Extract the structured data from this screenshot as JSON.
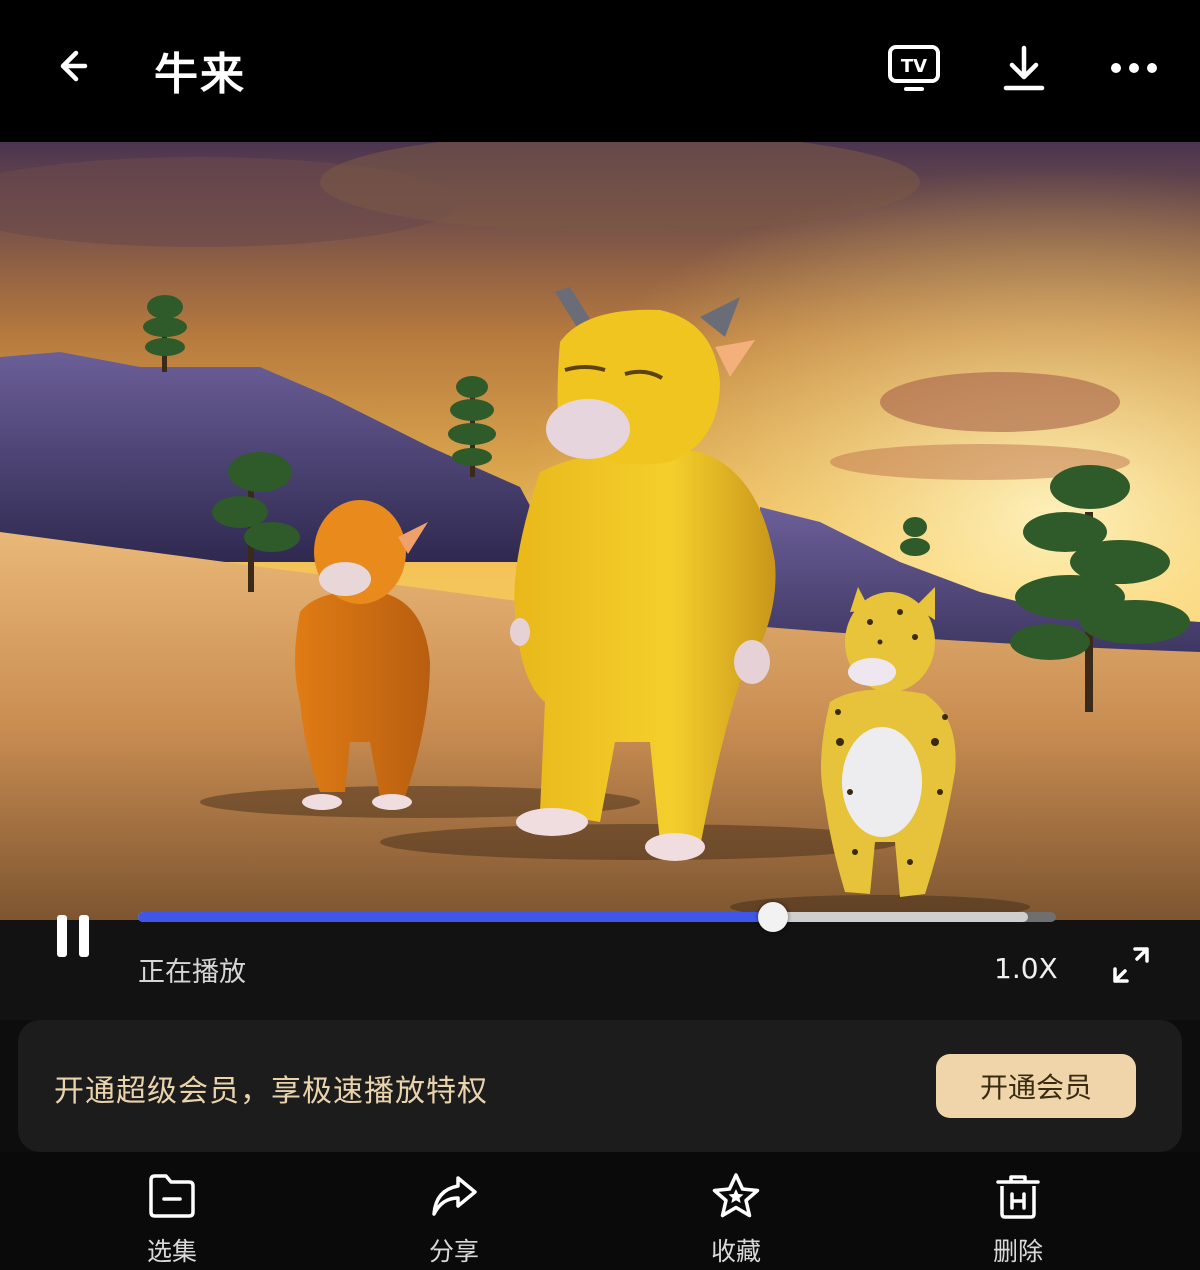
{
  "header": {
    "title": "牛来",
    "back_icon": "arrow-left-icon",
    "tv_icon": "tv-cast-icon",
    "tv_label": "TV",
    "download_icon": "download-icon",
    "more_icon": "more-horizontal-icon"
  },
  "player": {
    "status_text": "正在播放",
    "speed": "1.0X",
    "progress": 0.692,
    "buffered": 0.97,
    "progress_color": "#3f57e8",
    "pause_icon": "pause-icon",
    "fullscreen_icon": "fullscreen-icon"
  },
  "promo": {
    "text": "开通超级会员，享极速播放特权",
    "button": "开通会员",
    "accent_color": "#efd5a9"
  },
  "toolbar": {
    "items": [
      {
        "label": "选集",
        "icon": "folder-icon"
      },
      {
        "label": "分享",
        "icon": "share-icon"
      },
      {
        "label": "收藏",
        "icon": "star-icon"
      },
      {
        "label": "删除",
        "icon": "trash-icon"
      }
    ]
  }
}
